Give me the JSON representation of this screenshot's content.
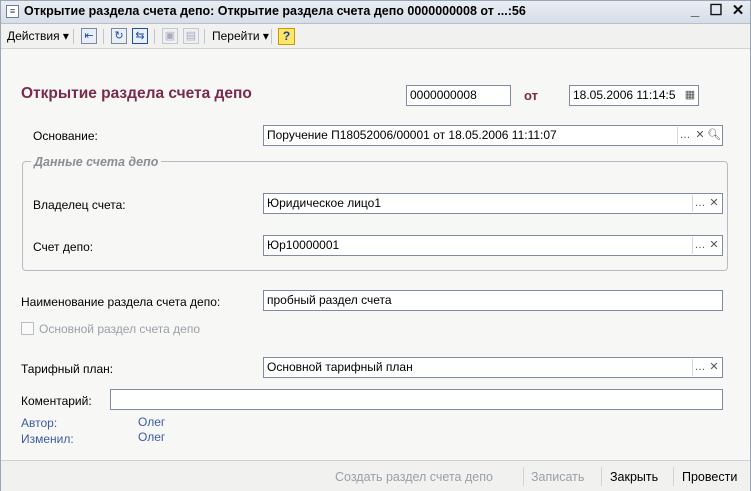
{
  "window": {
    "title": "Открытие раздела счета депо: Открытие раздела счета депо 0000000008 от ...:56",
    "controls": {
      "minimize": "_",
      "maximize": "☐",
      "close": "✕"
    }
  },
  "toolbar": {
    "actions_label": "Действия ▾",
    "goto_label": "Перейти ▾",
    "help_label": "?"
  },
  "form": {
    "heading": "Открытие раздела счета депо",
    "number": "0000000008",
    "from_label": "от",
    "date": "18.05.2006 11:14:5",
    "basis_label": "Основание:",
    "basis_value": "Поручение П18052006/00001 от 18.05.2006 11:11:07",
    "group_title": "Данные счета депо",
    "owner_label": "Владелец счета:",
    "owner_value": "Юридическое лицо1",
    "account_label": "Счет депо:",
    "account_value": "Юр10000001",
    "section_name_label": "Наименование раздела счета депо:",
    "section_name_value": "пробный раздел счета",
    "main_section_label": "Основной раздел счета депо",
    "tariff_label": "Тарифный план:",
    "tariff_value": "Основной тарифный план",
    "comment_label": "Коментарий:",
    "comment_value": "",
    "author_label": "Автор:",
    "author_value": "Олег",
    "changed_label": "Изменил:",
    "changed_value": "Олег"
  },
  "footer": {
    "create_section": "Создать раздел счета депо",
    "save": "Записать",
    "close": "Закрыть",
    "post": "Провести"
  },
  "colors": {
    "heading": "#7a2a4a",
    "link": "#3b5aa8",
    "disabled": "#9aa0a8"
  }
}
